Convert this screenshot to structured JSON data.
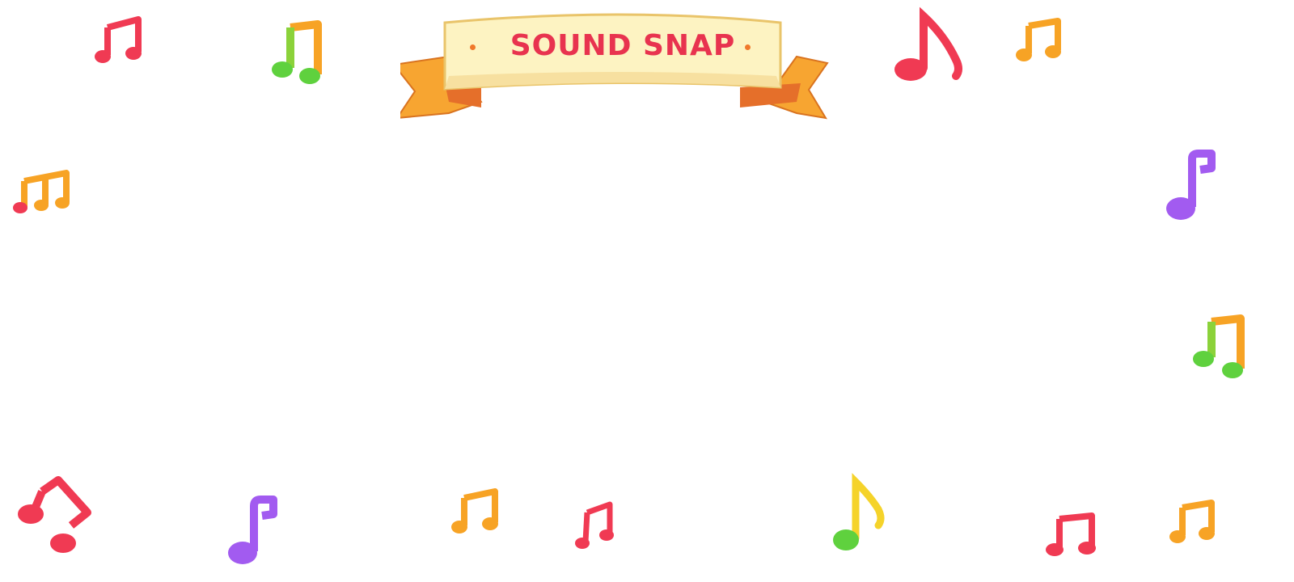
{
  "banner": {
    "title": "SOUND SNAP"
  },
  "colors": {
    "ribbon_cream": "#fdf3c2",
    "ribbon_tail": "#f7a531",
    "ribbon_fold": "#e56f2a",
    "title_red": "#e8334f",
    "note_red": "#f03a53",
    "note_orange": "#f7a325",
    "note_green": "#5fd13e",
    "note_purple": "#a25bf0",
    "note_yellow": "#f5d32a"
  },
  "notes": [
    {
      "icon": "beamed-eighth-notes-icon",
      "color": "red"
    },
    {
      "icon": "beamed-eighth-notes-icon",
      "color": "green-orange"
    },
    {
      "icon": "eighth-note-icon",
      "color": "red"
    },
    {
      "icon": "beamed-eighth-notes-icon",
      "color": "orange"
    },
    {
      "icon": "beamed-triplet-notes-icon",
      "color": "orange"
    },
    {
      "icon": "quarter-note-icon",
      "color": "purple"
    },
    {
      "icon": "beamed-eighth-notes-icon",
      "color": "green-orange"
    },
    {
      "icon": "beamed-eighth-notes-icon",
      "color": "red"
    },
    {
      "icon": "quarter-note-icon",
      "color": "purple"
    },
    {
      "icon": "beamed-eighth-notes-icon",
      "color": "orange"
    },
    {
      "icon": "beamed-eighth-notes-icon",
      "color": "red"
    },
    {
      "icon": "eighth-note-icon",
      "color": "green-yellow"
    },
    {
      "icon": "beamed-eighth-notes-icon",
      "color": "red"
    },
    {
      "icon": "beamed-eighth-notes-icon",
      "color": "orange"
    }
  ]
}
